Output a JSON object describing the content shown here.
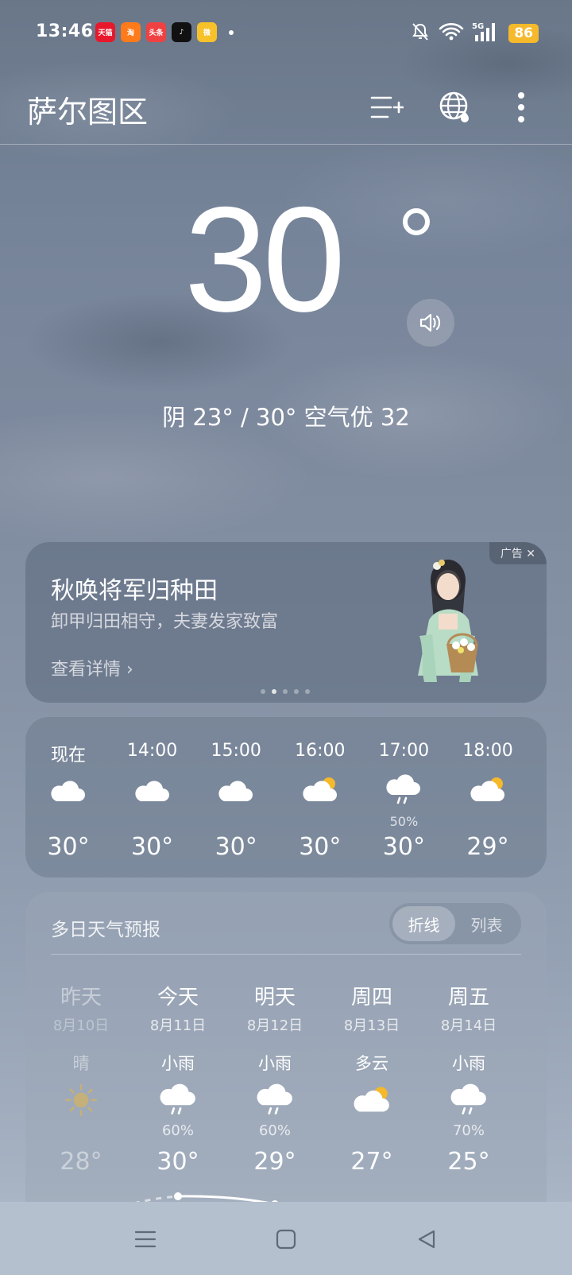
{
  "status_bar": {
    "time": "13:46",
    "apps": [
      {
        "name": "tmall-app-icon",
        "label": "天猫",
        "bg": "#e8182c"
      },
      {
        "name": "taobao-app-icon",
        "label": "淘",
        "bg": "#ff7a1a"
      },
      {
        "name": "toutiao-app-icon",
        "label": "头条",
        "bg": "#f04142"
      },
      {
        "name": "douyin-app-icon",
        "label": "♪",
        "bg": "#111111"
      },
      {
        "name": "weibo-app-icon",
        "label": "微",
        "bg": "#f7c12a"
      }
    ],
    "network": "5G",
    "battery": "86"
  },
  "header": {
    "location": "萨尔图区"
  },
  "current": {
    "temperature": "30",
    "summary": "阴  23° / 30°  空气优 32"
  },
  "ad": {
    "tag": "广告 ✕",
    "title": "秋唤将军归种田",
    "subtitle": "卸甲归田相守，夫妻发家致富",
    "link": "查看详情 ›",
    "dots": 5,
    "active_dot": 1
  },
  "hourly": [
    {
      "time": "现在",
      "icon": "cloudy-icon",
      "pop": "",
      "temp": "30°"
    },
    {
      "time": "14:00",
      "icon": "cloudy-icon",
      "pop": "",
      "temp": "30°"
    },
    {
      "time": "15:00",
      "icon": "cloudy-icon",
      "pop": "",
      "temp": "30°"
    },
    {
      "time": "16:00",
      "icon": "partly-cloudy-icon",
      "pop": "",
      "temp": "30°"
    },
    {
      "time": "17:00",
      "icon": "light-rain-icon",
      "pop": "50%",
      "temp": "30°"
    },
    {
      "time": "18:00",
      "icon": "partly-cloudy-icon",
      "pop": "",
      "temp": "29°"
    }
  ],
  "daily": {
    "title": "多日天气预报",
    "toggle_selected": "折线",
    "toggle_other": "列表",
    "days": [
      {
        "name": "昨天",
        "date": "8月10日",
        "cond": "晴",
        "icon": "sunny-icon",
        "pop": "",
        "temp": "28°",
        "past": true
      },
      {
        "name": "今天",
        "date": "8月11日",
        "cond": "小雨",
        "icon": "light-rain-icon",
        "pop": "60%",
        "temp": "30°",
        "past": false
      },
      {
        "name": "明天",
        "date": "8月12日",
        "cond": "小雨",
        "icon": "light-rain-icon",
        "pop": "60%",
        "temp": "29°",
        "past": false
      },
      {
        "name": "周四",
        "date": "8月13日",
        "cond": "多云",
        "icon": "partly-cloudy-icon",
        "pop": "",
        "temp": "27°",
        "past": false
      },
      {
        "name": "周五",
        "date": "8月14日",
        "cond": "小雨",
        "icon": "light-rain-icon",
        "pop": "70%",
        "temp": "25°",
        "past": false
      }
    ]
  },
  "colors": {
    "sun": "#f5b92b",
    "battery": "#f5b92b"
  }
}
